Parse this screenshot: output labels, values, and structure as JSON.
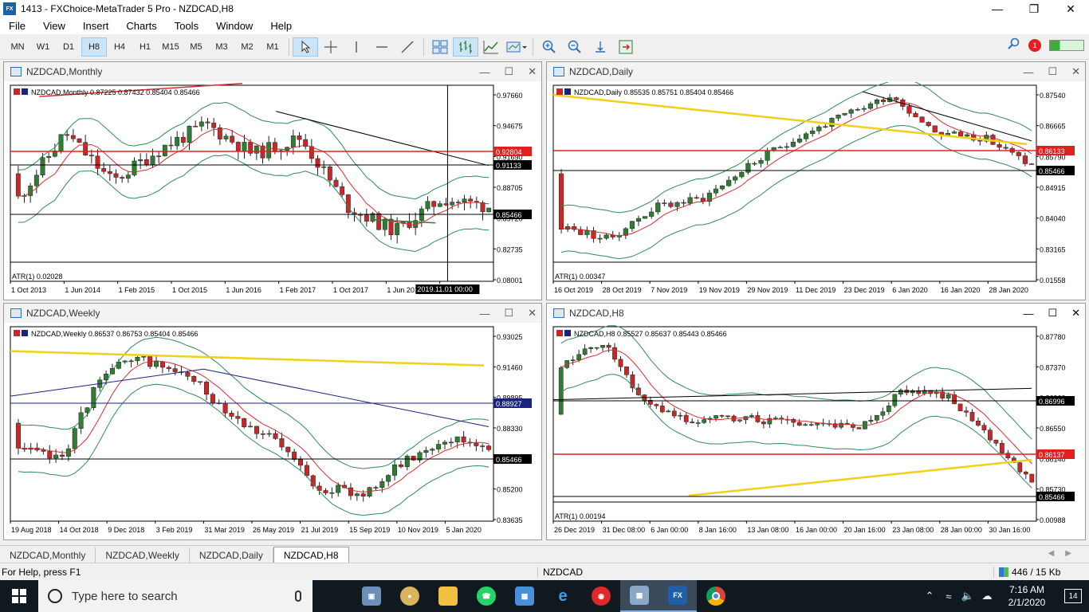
{
  "window": {
    "title": "1413 - FXChoice-MetaTrader 5 Pro - NZDCAD,H8",
    "icon_text": "FX"
  },
  "menu": [
    "File",
    "View",
    "Insert",
    "Charts",
    "Tools",
    "Window",
    "Help"
  ],
  "toolbar": {
    "timeframes": [
      "MN",
      "W1",
      "D1",
      "H8",
      "H4",
      "H1",
      "M15",
      "M5",
      "M3",
      "M2",
      "M1"
    ],
    "active_timeframe": "H8",
    "notification_count": "1"
  },
  "charts": [
    {
      "id": "monthly",
      "window_title": "NZDCAD,Monthly",
      "header": "NZDCAD,Monthly  0.87225 0.87432 0.85404 0.85466",
      "y_ticks": [
        "0.97660",
        "0.94675",
        "0.91690",
        "0.88705",
        "0.85720",
        "0.82735",
        "0.08001"
      ],
      "price_tags": [
        {
          "value": "0.92804",
          "kind": "red"
        },
        {
          "value": "0.91133",
          "kind": "black"
        },
        {
          "value": "0.85466",
          "kind": "black"
        }
      ],
      "x_ticks": [
        "1 Oct 2013",
        "1 Jun 2014",
        "1 Feb 2015",
        "1 Oct 2015",
        "1 Jun 2016",
        "1 Feb 2017",
        "1 Oct 2017",
        "1 Jun 2018",
        "1 Feb 2"
      ],
      "crosshair_label": "2019.11.01 00:00",
      "atr_label": "ATR(1) 0.02028",
      "seed": 11
    },
    {
      "id": "daily",
      "window_title": "NZDCAD,Daily",
      "header": "NZDCAD,Daily  0.85535 0.85751 0.85404 0.85466",
      "y_ticks": [
        "0.87540",
        "0.86665",
        "0.85790",
        "0.84915",
        "0.84040",
        "0.83165",
        "0.01558"
      ],
      "price_tags": [
        {
          "value": "0.86133",
          "kind": "red"
        },
        {
          "value": "0.85466",
          "kind": "black"
        }
      ],
      "x_ticks": [
        "16 Oct 2019",
        "28 Oct 2019",
        "7 Nov 2019",
        "19 Nov 2019",
        "29 Nov 2019",
        "11 Dec 2019",
        "23 Dec 2019",
        "6 Jan 2020",
        "16 Jan 2020",
        "28 Jan 2020"
      ],
      "atr_label": "ATR(1) 0.00347",
      "seed": 23
    },
    {
      "id": "weekly",
      "window_title": "NZDCAD,Weekly",
      "header": "NZDCAD,Weekly  0.86537 0.86753 0.85404 0.85466",
      "y_ticks": [
        "0.93025",
        "0.91460",
        "0.89895",
        "0.88330",
        "0.86765",
        "0.85200",
        "0.83635"
      ],
      "price_tags": [
        {
          "value": "0.88927",
          "kind": "blue"
        },
        {
          "value": "0.85466",
          "kind": "black"
        }
      ],
      "x_ticks": [
        "19 Aug 2018",
        "14 Oct 2018",
        "9 Dec 2018",
        "3 Feb 2019",
        "31 Mar 2019",
        "26 May 2019",
        "21 Jul 2019",
        "15 Sep 2019",
        "10 Nov 2019",
        "5 Jan 2020"
      ],
      "seed": 37
    },
    {
      "id": "h8",
      "window_title": "NZDCAD,H8",
      "header": "NZDCAD,H8  0.85527 0.85637 0.85443 0.85466",
      "y_ticks": [
        "0.87780",
        "0.87370",
        "0.86960",
        "0.86550",
        "0.86140",
        "0.85730",
        "0.00988"
      ],
      "price_tags": [
        {
          "value": "0.86996",
          "kind": "black"
        },
        {
          "value": "0.86137",
          "kind": "red"
        },
        {
          "value": "0.85466",
          "kind": "black"
        }
      ],
      "x_ticks": [
        "26 Dec 2019",
        "31 Dec 08:00",
        "6 Jan 00:00",
        "8 Jan 16:00",
        "13 Jan 08:00",
        "16 Jan 00:00",
        "20 Jan 16:00",
        "23 Jan 08:00",
        "28 Jan 00:00",
        "30 Jan 16:00"
      ],
      "atr_label": "ATR(1) 0.00194",
      "seed": 51
    }
  ],
  "tabs": [
    "NZDCAD,Monthly",
    "NZDCAD,Weekly",
    "NZDCAD,Daily",
    "NZDCAD,H8"
  ],
  "active_tab": "NZDCAD,H8",
  "status": {
    "help": "For Help, press F1",
    "symbol": "NZDCAD",
    "traffic": "446 / 15 Kb"
  },
  "taskbar": {
    "search_placeholder": "Type here to search",
    "time": "7:16 AM",
    "date": "2/1/2020",
    "notification_count": "14",
    "apps": [
      "file-explorer",
      "paint",
      "folder",
      "whatsapp",
      "remote-desktop",
      "internet-explorer",
      "screen-recorder",
      "mt5-pinned",
      "fxchoice",
      "chrome"
    ]
  },
  "colors": {
    "bull": "#2e7d32",
    "bear": "#c62828",
    "ma_red": "#d32f2f",
    "bands": "#2e8b57",
    "yellow_line": "#f2d017",
    "blue_ma": "#1a237e"
  }
}
